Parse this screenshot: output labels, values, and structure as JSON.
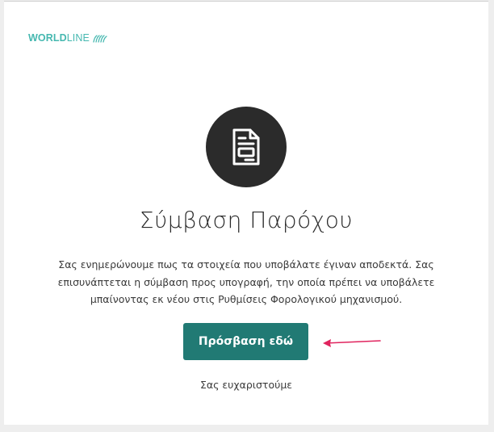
{
  "brand": {
    "logo_bold": "WORLD",
    "logo_thin": "LINE",
    "color": "#46b8b0"
  },
  "main": {
    "icon": "document-icon",
    "title": "Σύμβαση Παρόχου",
    "message": "Σας ενημερώνουμε πως τα στοιχεία που υποβάλατε έγιναν αποδεκτά. Σας επισυνάπτεται η σύμβαση προς υπογραφή, την οποία πρέπει να υποβάλετε μπαίνοντας εκ νέου στις Ρυθμίσεις Φορολογικού μηχανισμού.",
    "cta_label": "Πρόσβαση εδώ",
    "thanks": "Σας ευχαριστούμε"
  },
  "colors": {
    "button": "#217a74",
    "icon_circle": "#2b2b2b",
    "annotation_arrow": "#e0245e"
  }
}
